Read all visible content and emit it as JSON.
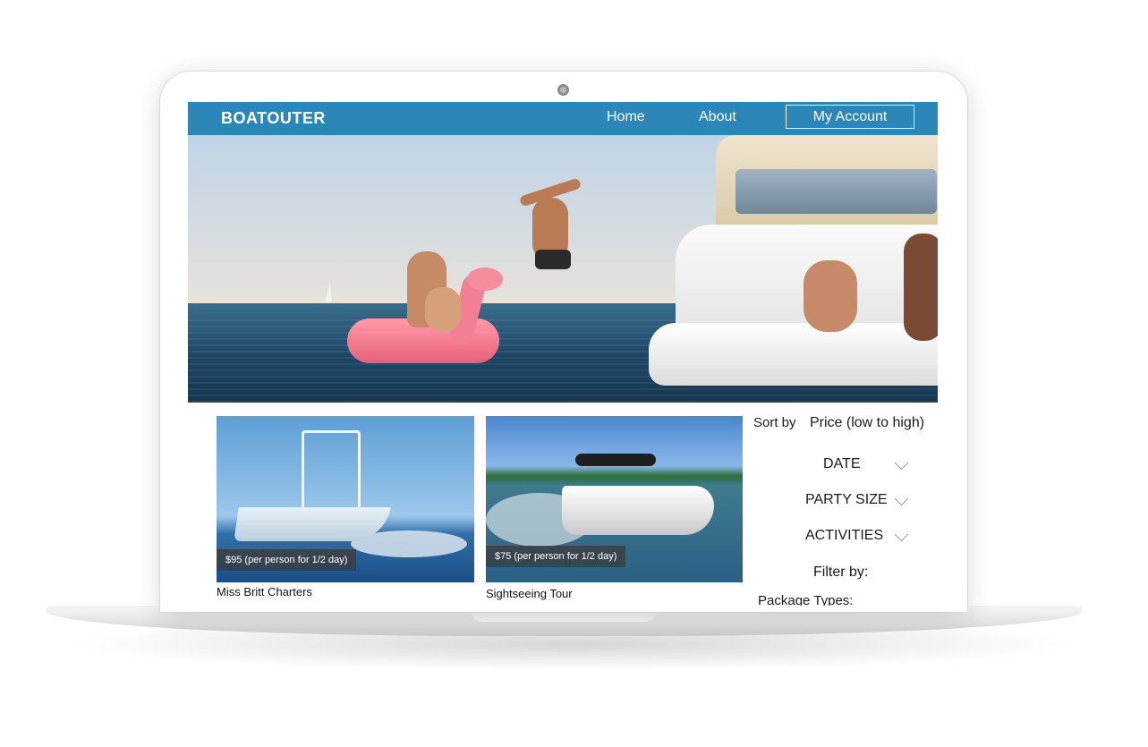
{
  "navbar": {
    "brand": "BOATOUTER",
    "links": [
      "Home",
      "About"
    ],
    "account_button": "My Account"
  },
  "listings": [
    {
      "price": "$95 (per person for 1/2 day)",
      "title": "Miss Britt Charters"
    },
    {
      "price": "$75 (per person for 1/2 day)",
      "title": "Sightseeing Tour"
    }
  ],
  "sort": {
    "label": "Sort by",
    "selected": "Price (low to high)"
  },
  "filters": {
    "dropdowns": [
      "DATE",
      "PARTY SIZE",
      "ACTIVITIES"
    ],
    "filter_by": "Filter by:",
    "package_types": "Package Types:"
  },
  "colors": {
    "navbar": "#2d86b8"
  },
  "icons": {
    "dropdown": "chevron-down-icon"
  }
}
